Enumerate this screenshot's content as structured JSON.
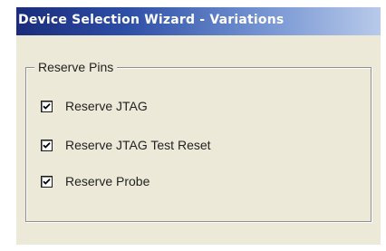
{
  "window": {
    "title": "Device Selection Wizard - Variations"
  },
  "reserve_pins": {
    "label": "Reserve Pins",
    "options": [
      {
        "label": "Reserve JTAG",
        "checked": true
      },
      {
        "label": "Reserve JTAG Test Reset",
        "checked": true
      },
      {
        "label": "Reserve Probe",
        "checked": true
      }
    ]
  }
}
